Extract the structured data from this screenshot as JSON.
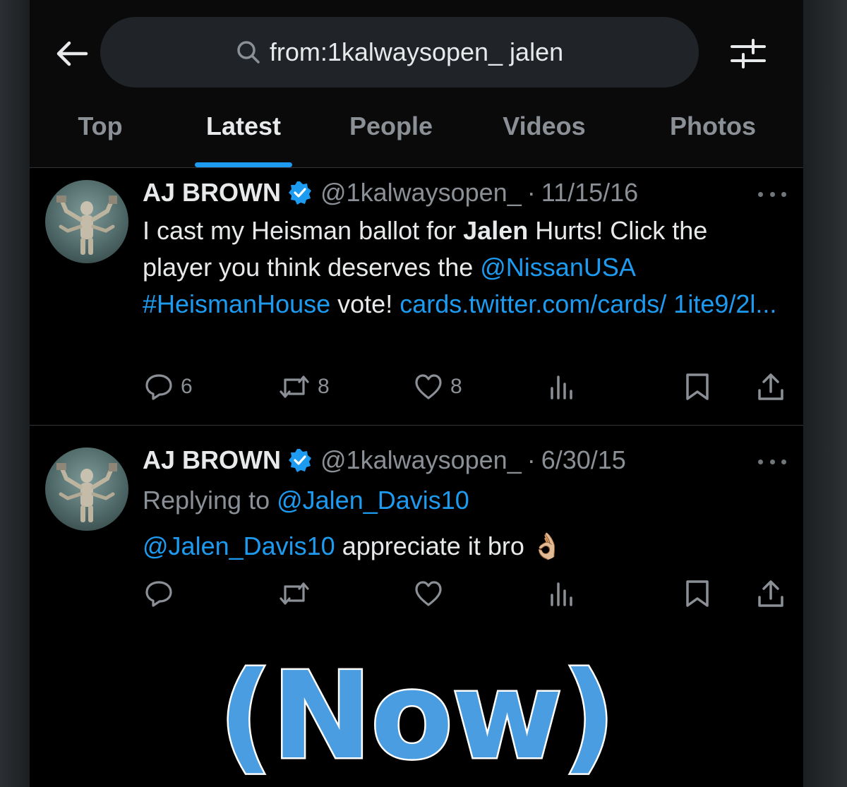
{
  "search": {
    "query": "from:1kalwaysopen_ jalen"
  },
  "tabs": [
    {
      "label": "Top",
      "active": false
    },
    {
      "label": "Latest",
      "active": true
    },
    {
      "label": "People",
      "active": false
    },
    {
      "label": "Videos",
      "active": false
    },
    {
      "label": "Photos",
      "active": false
    }
  ],
  "tweets": [
    {
      "name": "AJ BROWN",
      "handle": "@1kalwaysopen_",
      "separator": "·",
      "date": "11/15/16",
      "text": {
        "part1": "I cast my Heisman ballot for ",
        "bold": "Jalen",
        "part2": " Hurts! Click the player you think deserves the ",
        "mention": "@NissanUSA",
        "part3": " ",
        "hashtag": "#HeismanHouse",
        "part4": " vote! ",
        "url": "cards.twitter.com/cards/ 1ite9/2l..."
      },
      "replies": "6",
      "retweets": "8",
      "likes": "8"
    },
    {
      "name": "AJ BROWN",
      "handle": "@1kalwaysopen_",
      "separator": "·",
      "date": "6/30/15",
      "replying_prefix": "Replying to ",
      "replying_to": "@Jalen_Davis10",
      "text": {
        "mention": "@Jalen_Davis10",
        "rest": " appreciate it bro ",
        "emoji": "👌🏼"
      }
    }
  ],
  "caption": "(Now)",
  "icons": {
    "back": "arrow-left-icon",
    "search": "search-icon",
    "filter": "sliders-icon",
    "verified": "verified-badge-icon",
    "reply": "reply-icon",
    "retweet": "retweet-icon",
    "like": "heart-icon",
    "views": "views-icon",
    "bookmark": "bookmark-icon",
    "share": "share-icon"
  },
  "colors": {
    "accent": "#1d9bf0",
    "caption_fill": "#4a9de0"
  }
}
